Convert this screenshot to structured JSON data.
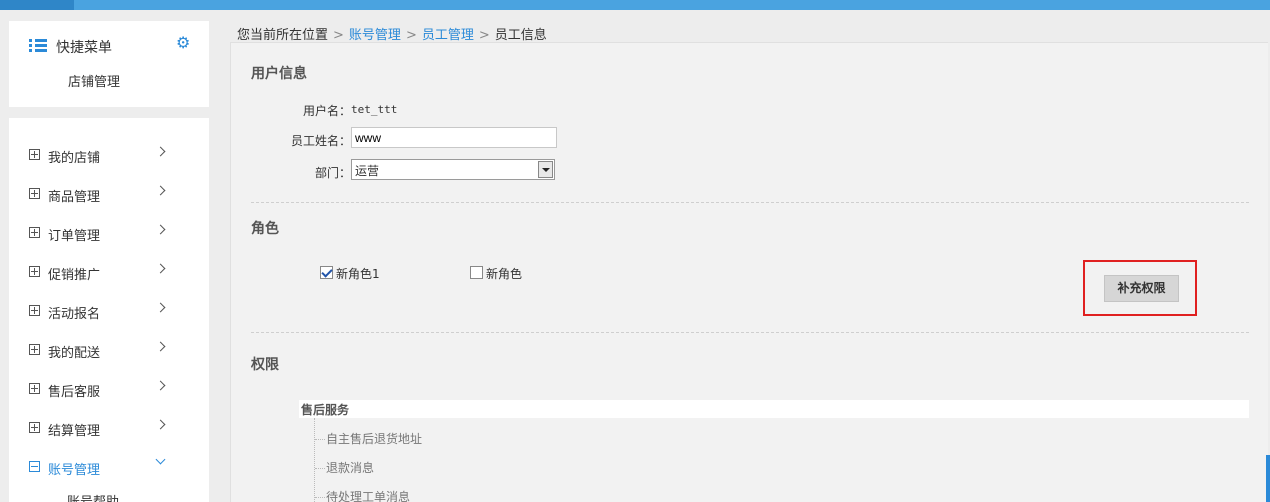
{
  "quick_menu": {
    "title": "快捷菜单",
    "gear_icon": "gear-icon",
    "item": "店铺管理"
  },
  "sidebar": {
    "items": [
      {
        "label": "我的店铺",
        "expanded": false
      },
      {
        "label": "商品管理",
        "expanded": false
      },
      {
        "label": "订单管理",
        "expanded": false
      },
      {
        "label": "促销推广",
        "expanded": false
      },
      {
        "label": "活动报名",
        "expanded": false
      },
      {
        "label": "我的配送",
        "expanded": false
      },
      {
        "label": "售后客服",
        "expanded": false
      },
      {
        "label": "结算管理",
        "expanded": false
      },
      {
        "label": "账号管理",
        "expanded": true
      }
    ],
    "partial_subitem": "账号帮助"
  },
  "breadcrumb": {
    "prefix": "您当前所在位置",
    "items": [
      "账号管理",
      "员工管理",
      "员工信息"
    ]
  },
  "user_info": {
    "title": "用户信息",
    "username_label": "用户名：",
    "username_value": "tet_ttt",
    "name_label": "员工姓名：",
    "name_value": "www",
    "dept_label": "部门：",
    "dept_value": "运营"
  },
  "roles": {
    "title": "角色",
    "items": [
      {
        "label": "新角色1",
        "checked": true
      },
      {
        "label": "新角色",
        "checked": false
      }
    ],
    "add_button": "补充权限"
  },
  "permissions": {
    "title": "权限",
    "group": "售后服务",
    "items": [
      "自主售后退货地址",
      "退款消息",
      "待处理工单消息"
    ]
  },
  "colors": {
    "accent": "#2b8ad8",
    "topbar": "#4aa3e0",
    "highlight": "#e02020"
  }
}
